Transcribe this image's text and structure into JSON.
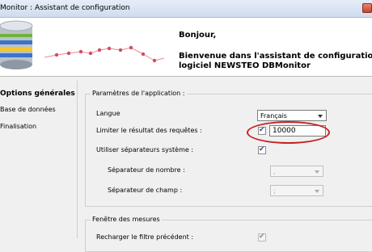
{
  "window": {
    "title": "Monitor : Assistant de configuration",
    "close_icon": "close-icon"
  },
  "header": {
    "greeting": "Bonjour,",
    "welcome_line1": "Bienvenue dans l'assistant de configuration du",
    "welcome_line2": "logiciel NEWSTEO DBMonitor",
    "logo_icon": "database-icon"
  },
  "sidebar": {
    "items": [
      {
        "label": "Options générales",
        "active": true
      },
      {
        "label": "Base de données",
        "active": false
      },
      {
        "label": "Finalisation",
        "active": false
      }
    ]
  },
  "app_params": {
    "legend": "Paramètres de l'application :",
    "language_label": "Langue",
    "language_value": "Français",
    "limit_label": "Limiter le résultat des requêtes :",
    "limit_checked": true,
    "limit_value": "10000",
    "use_sys_sep_label": "Utiliser séparateurs système :",
    "use_sys_sep_checked": true,
    "number_sep_label": "Séparateur de nombre :",
    "number_sep_value": ",",
    "field_sep_label": "Séparateur de champ :",
    "field_sep_value": ";"
  },
  "measures": {
    "legend": "Fenêtre des mesures",
    "reload_filter_label": "Recharger le filtre précédent :",
    "reload_filter_checked": true
  },
  "colors": {
    "annotation": "#c22222",
    "chart_line": "#e07070",
    "chart_points": "#d24a6a"
  }
}
